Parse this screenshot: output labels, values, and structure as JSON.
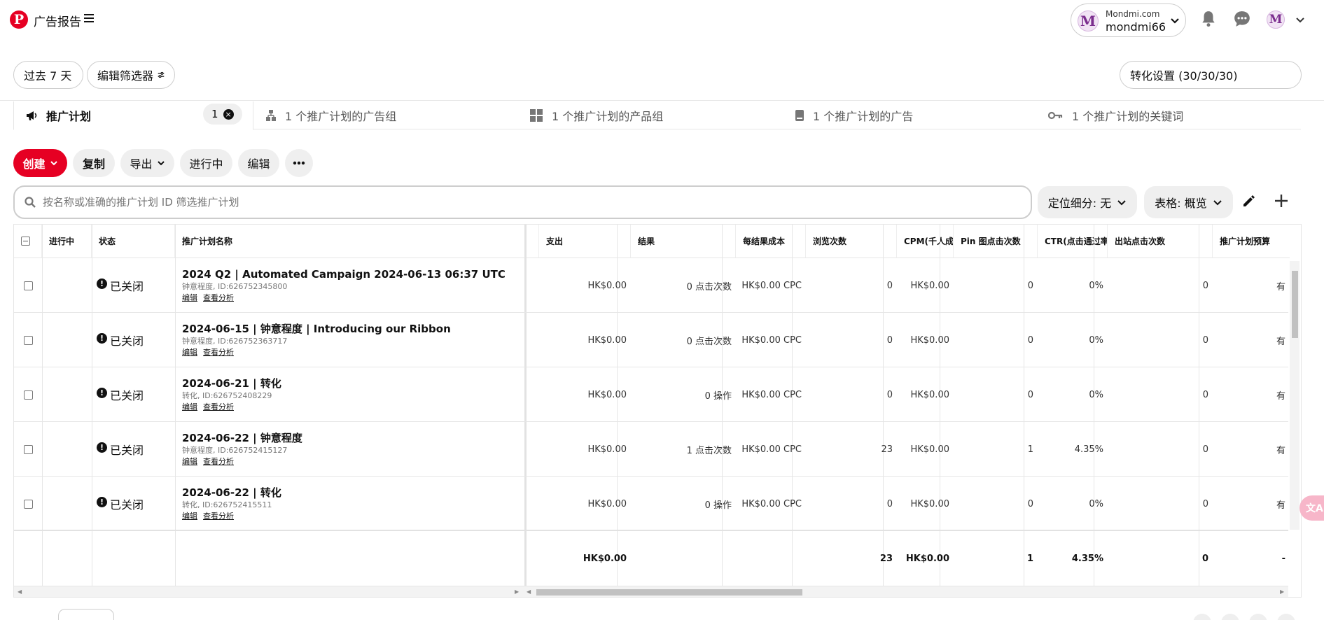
{
  "header": {
    "app_title": "广告报告",
    "logo_letter": "P",
    "account": {
      "domain": "Mondmi.com",
      "username": "mondmi66",
      "avatar_letter": "M"
    },
    "user_avatar_letter": "M"
  },
  "filters": {
    "date_range": "过去 7 天",
    "edit_filters": "编辑筛选器",
    "conversion_settings": "转化设置 (30/30/30)"
  },
  "level_tabs": {
    "campaigns": {
      "label": "推广计划",
      "count": "1",
      "clear": "×"
    },
    "ad_groups": "1 个推广计划的广告组",
    "product_groups": "1 个推广计划的产品组",
    "ads": "1 个推广计划的广告",
    "keywords": "1 个推广计划的关键词"
  },
  "actions": {
    "create": "创建",
    "copy": "复制",
    "export": "导出",
    "active": "进行中",
    "edit": "编辑",
    "more": "•••"
  },
  "search": {
    "placeholder": "按名称或准确的推广计划 ID 筛选推广计划"
  },
  "selectors": {
    "targeting": "定位细分: 无",
    "table": "表格: 概览"
  },
  "table": {
    "headers": {
      "on": "进行中",
      "status": "状态",
      "name": "推广计划名称",
      "spend": "支出",
      "results": "结果",
      "cost_per_result": "每结果成本",
      "impressions": "浏览次数",
      "cpm": "CPM(千人成本)",
      "pin_clicks": "Pin 图点击次数",
      "ctr": "CTR(点击通过率)",
      "outbound_clicks": "出站点击次数",
      "budget": "推广计划预算"
    },
    "link_edit": "编辑",
    "link_analytics": "查看分析",
    "rows": [
      {
        "status": "已关闭",
        "name": "2024 Q2 | Automated Campaign 2024-06-13 06:37 UTC",
        "meta": "钟意程度, ID:626752345800",
        "spend": "HK$0.00",
        "results": "0 点击次数",
        "cpr": "HK$0.00 CPC",
        "impressions": "0",
        "cpm": "HK$0.00",
        "pin_clicks": "0",
        "ctr": "0%",
        "outbound": "0",
        "budget": "有"
      },
      {
        "status": "已关闭",
        "name": "2024-06-15 | 钟意程度 | Introducing our Ribbon",
        "meta": "钟意程度, ID:626752363717",
        "spend": "HK$0.00",
        "results": "0 点击次数",
        "cpr": "HK$0.00 CPC",
        "impressions": "0",
        "cpm": "HK$0.00",
        "pin_clicks": "0",
        "ctr": "0%",
        "outbound": "0",
        "budget": "有"
      },
      {
        "status": "已关闭",
        "name": "2024-06-21 | 转化",
        "meta": "转化, ID:626752408229",
        "spend": "HK$0.00",
        "results": "0 操作",
        "cpr": "HK$0.00 CPC",
        "impressions": "0",
        "cpm": "HK$0.00",
        "pin_clicks": "0",
        "ctr": "0%",
        "outbound": "0",
        "budget": "有"
      },
      {
        "status": "已关闭",
        "name": "2024-06-22 | 钟意程度",
        "meta": "钟意程度, ID:626752415127",
        "spend": "HK$0.00",
        "results": "1 点击次数",
        "cpr": "HK$0.00 CPC",
        "impressions": "23",
        "cpm": "HK$0.00",
        "pin_clicks": "1",
        "ctr": "4.35%",
        "outbound": "0",
        "budget": "有"
      },
      {
        "status": "已关闭",
        "name": "2024-06-22 | 转化",
        "meta": "转化, ID:626752415511",
        "spend": "HK$0.00",
        "results": "0 操作",
        "cpr": "HK$0.00 CPC",
        "impressions": "0",
        "cpm": "HK$0.00",
        "pin_clicks": "0",
        "ctr": "0%",
        "outbound": "0",
        "budget": "有"
      }
    ],
    "totals": {
      "spend": "HK$0.00",
      "impressions": "23",
      "cpm": "HK$0.00",
      "pin_clicks": "1",
      "ctr": "4.35%",
      "outbound": "0",
      "budget": "-"
    }
  },
  "translate_fab": "文A",
  "colors": {
    "brand": "#e60023",
    "pill_bg": "#efefef",
    "border": "#cdcdcd"
  }
}
